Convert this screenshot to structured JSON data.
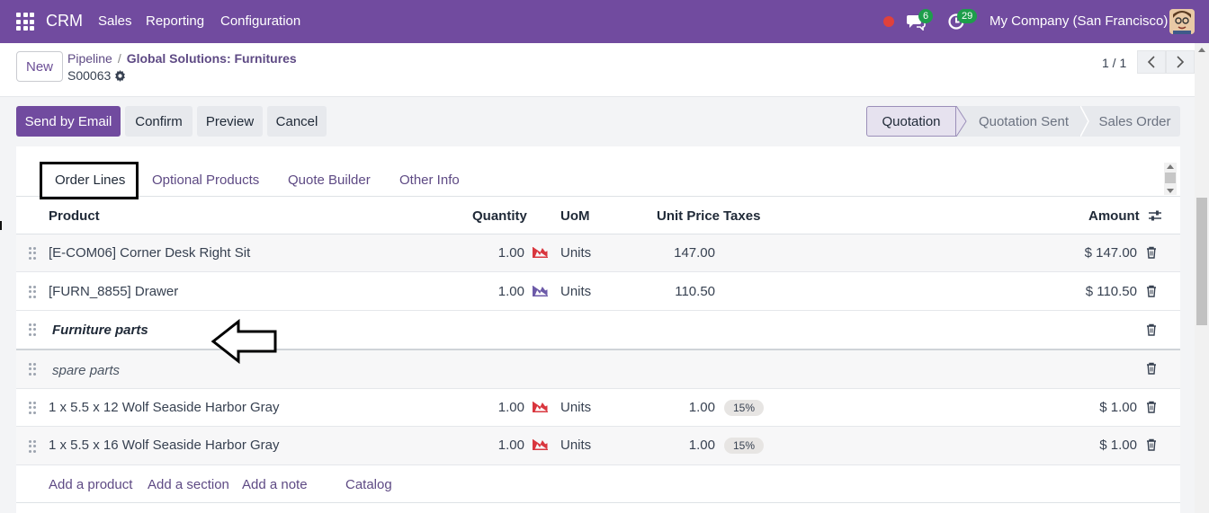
{
  "nav": {
    "app": "CRM",
    "menus": [
      "Sales",
      "Reporting",
      "Configuration"
    ],
    "chat_count": "6",
    "activity_count": "29",
    "company": "My Company (San Francisco)"
  },
  "control": {
    "new_label": "New",
    "breadcrumb_parent": "Pipeline",
    "breadcrumb_sep": "/",
    "breadcrumb_current": "Global Solutions: Furnitures",
    "record_ref": "S00063",
    "pager": "1 / 1"
  },
  "actions": {
    "send_email": "Send by Email",
    "confirm": "Confirm",
    "preview": "Preview",
    "cancel": "Cancel"
  },
  "stages": [
    "Quotation",
    "Quotation Sent",
    "Sales Order"
  ],
  "active_stage": "Quotation",
  "tabs": [
    "Order Lines",
    "Optional Products",
    "Quote Builder",
    "Other Info"
  ],
  "columns": {
    "product": "Product",
    "quantity": "Quantity",
    "uom": "UoM",
    "unit_price": "Unit Price",
    "taxes": "Taxes",
    "amount": "Amount"
  },
  "lines": [
    {
      "type": "product",
      "product": "[E-COM06] Corner Desk Right Sit",
      "quantity": "1.00",
      "forecast": "red",
      "uom": "Units",
      "unit_price": "147.00",
      "taxes": "",
      "amount": "$ 147.00"
    },
    {
      "type": "product",
      "product": "[FURN_8855] Drawer",
      "quantity": "1.00",
      "forecast": "purple",
      "uom": "Units",
      "unit_price": "110.50",
      "taxes": "",
      "amount": "$ 110.50"
    },
    {
      "type": "section",
      "product": "Furniture parts"
    },
    {
      "type": "note",
      "product": "spare parts"
    },
    {
      "type": "product",
      "product": "1 x 5.5 x 12 Wolf Seaside Harbor Gray",
      "quantity": "1.00",
      "forecast": "red",
      "uom": "Units",
      "unit_price": "1.00",
      "taxes": "15%",
      "amount": "$ 1.00"
    },
    {
      "type": "product",
      "product": "1 x 5.5 x 16 Wolf Seaside Harbor Gray",
      "quantity": "1.00",
      "forecast": "red",
      "uom": "Units",
      "unit_price": "1.00",
      "taxes": "15%",
      "amount": "$ 1.00"
    }
  ],
  "add_links": {
    "product": "Add a product",
    "section": "Add a section",
    "note": "Add a note",
    "catalog": "Catalog"
  },
  "colors": {
    "brand": "#714b9f",
    "forecast_red": "#d9363e",
    "forecast_purple": "#6c5aa8",
    "badge_green": "#1e9e4b"
  }
}
